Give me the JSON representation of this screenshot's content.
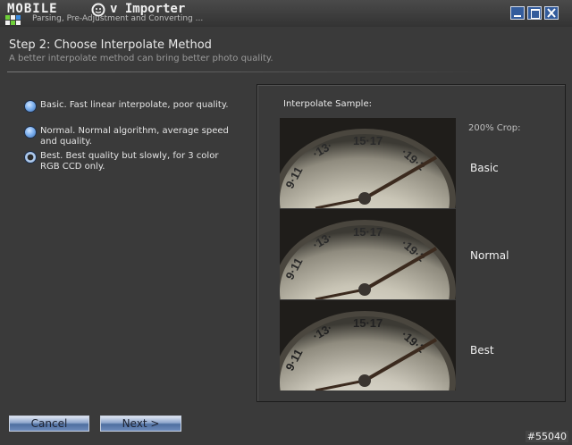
{
  "window": {
    "logo_text": "MOBILE",
    "title": "v Importer",
    "subtitle": "Parsing, Pre-Adjustment and Converting ...",
    "controls": [
      "minimize",
      "maximize",
      "close"
    ]
  },
  "step": {
    "title": "Step 2: Choose Interpolate Method",
    "description": "A better interpolate method can bring better photo quality."
  },
  "options": [
    {
      "label": "Basic. Fast linear interpolate, poor quality.",
      "selected": false
    },
    {
      "label": "Normal. Normal algorithm, average speed and quality.",
      "selected": false
    },
    {
      "label": "Best. Best quality but slowly, for 3 color RGB CCD only.",
      "selected": true
    }
  ],
  "sample_panel": {
    "title": "Interpolate Sample:",
    "crop_label": "200% Crop:",
    "samples": [
      {
        "label": "Basic"
      },
      {
        "label": "Normal"
      },
      {
        "label": "Best"
      }
    ]
  },
  "buttons": {
    "cancel": "Cancel",
    "next": "Next >"
  },
  "watermark": "#55040",
  "colors": {
    "accent_blue": "#335c9c",
    "background": "#3a3a3a"
  }
}
